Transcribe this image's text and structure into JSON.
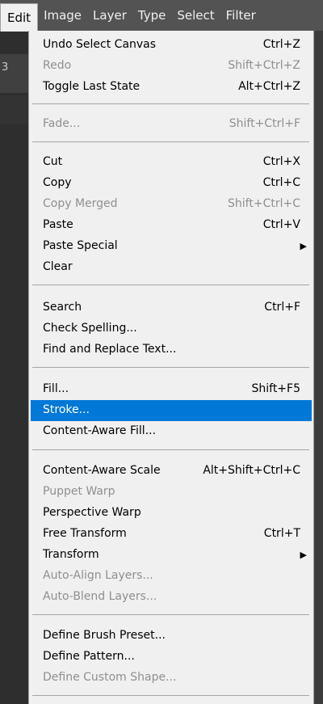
{
  "menubar": {
    "items": [
      "Edit",
      "Image",
      "Layer",
      "Type",
      "Select",
      "Filter"
    ]
  },
  "strip": {
    "glyph": "3"
  },
  "edit_menu": {
    "items": [
      {
        "label": "Undo Select Canvas",
        "shortcut": "Ctrl+Z",
        "disabled": false
      },
      {
        "label": "Redo",
        "shortcut": "Shift+Ctrl+Z",
        "disabled": true
      },
      {
        "label": "Toggle Last State",
        "shortcut": "Alt+Ctrl+Z",
        "disabled": false
      },
      {
        "label": "Fade...",
        "shortcut": "Shift+Ctrl+F",
        "disabled": true
      },
      {
        "label": "Cut",
        "shortcut": "Ctrl+X",
        "disabled": false
      },
      {
        "label": "Copy",
        "shortcut": "Ctrl+C",
        "disabled": false
      },
      {
        "label": "Copy Merged",
        "shortcut": "Shift+Ctrl+C",
        "disabled": true
      },
      {
        "label": "Paste",
        "shortcut": "Ctrl+V",
        "disabled": false
      },
      {
        "label": "Paste Special",
        "submenu": true,
        "disabled": false
      },
      {
        "label": "Clear",
        "disabled": false
      },
      {
        "label": "Search",
        "shortcut": "Ctrl+F",
        "disabled": false
      },
      {
        "label": "Check Spelling...",
        "disabled": false
      },
      {
        "label": "Find and Replace Text...",
        "disabled": false
      },
      {
        "label": "Fill...",
        "shortcut": "Shift+F5",
        "disabled": false
      },
      {
        "label": "Stroke...",
        "disabled": false,
        "selected": true
      },
      {
        "label": "Content-Aware Fill...",
        "disabled": false
      },
      {
        "label": "Content-Aware Scale",
        "shortcut": "Alt+Shift+Ctrl+C",
        "disabled": false
      },
      {
        "label": "Puppet Warp",
        "disabled": true
      },
      {
        "label": "Perspective Warp",
        "disabled": false
      },
      {
        "label": "Free Transform",
        "shortcut": "Ctrl+T",
        "disabled": false
      },
      {
        "label": "Transform",
        "submenu": true,
        "disabled": false
      },
      {
        "label": "Auto-Align Layers...",
        "disabled": true
      },
      {
        "label": "Auto-Blend Layers...",
        "disabled": true
      },
      {
        "label": "Define Brush Preset...",
        "disabled": false
      },
      {
        "label": "Define Pattern...",
        "disabled": false
      },
      {
        "label": "Define Custom Shape...",
        "disabled": true
      }
    ]
  },
  "colors": {
    "selection": "#0078d7",
    "menu_background": "#f0f0f0",
    "menubar_background": "#535353",
    "disabled_text": "#8f8f8f"
  },
  "icons": {
    "submenu_arrow": "chevron-right-icon"
  }
}
